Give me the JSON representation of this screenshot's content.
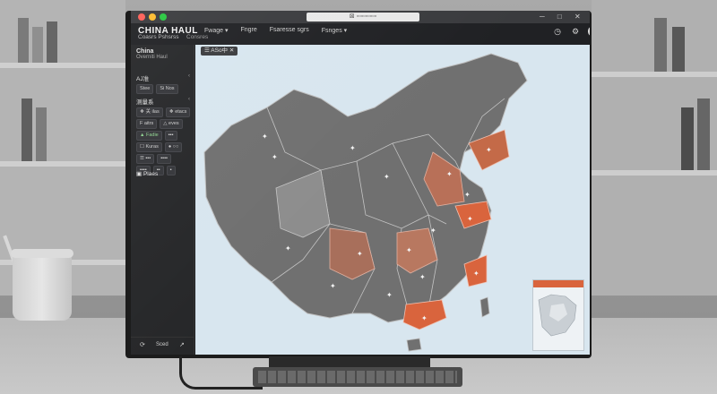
{
  "window": {
    "address": "⊠  ▫▫▫▫▫▫▫▫▫",
    "controls": "─ □ ✕"
  },
  "app": {
    "title": "CHINA HAUL",
    "menu": [
      "Fwage ▾",
      "Fngre",
      "Fsaresse sgrs",
      "Fsnges ▾"
    ],
    "crumbs": [
      "Coasrs Pshsrss",
      "Consres"
    ]
  },
  "sidebar": {
    "region_name": "China",
    "region_sub": "Overniti Haul",
    "section1": "AJ准",
    "section1_chips": [
      "Stee",
      "Si Nos"
    ],
    "section2": "测量系",
    "rows": [
      [
        "❖ 关 ilas",
        "❖ etacs"
      ],
      [
        "F aitrs",
        "△ eves"
      ],
      [
        "▲ Fadie",
        "▪▪▪"
      ],
      [
        "☐ Kuras",
        "● ○○"
      ],
      [
        "☰ ▪▪▪",
        "▪▪▪▪"
      ],
      [
        "▪▪▪▪",
        "▪▪",
        "▪"
      ]
    ],
    "panel_label": "Plaes",
    "bottom_left": "⟳",
    "bottom_mid": "Sced",
    "bottom_right": "↗"
  },
  "map": {
    "tab": "☰ ASo中 ✕",
    "colors": {
      "land": "#6f6f6f",
      "land_light": "#8d8d8d",
      "sea": "#d8e6ef",
      "highlight_strong": "#d9643d",
      "highlight_mid": "#b06a52",
      "highlight_soft": "#9a7468",
      "border": "#bdbdbd"
    }
  },
  "icons": {
    "top": [
      "clock-icon",
      "gear-icon",
      "user-avatar"
    ]
  }
}
